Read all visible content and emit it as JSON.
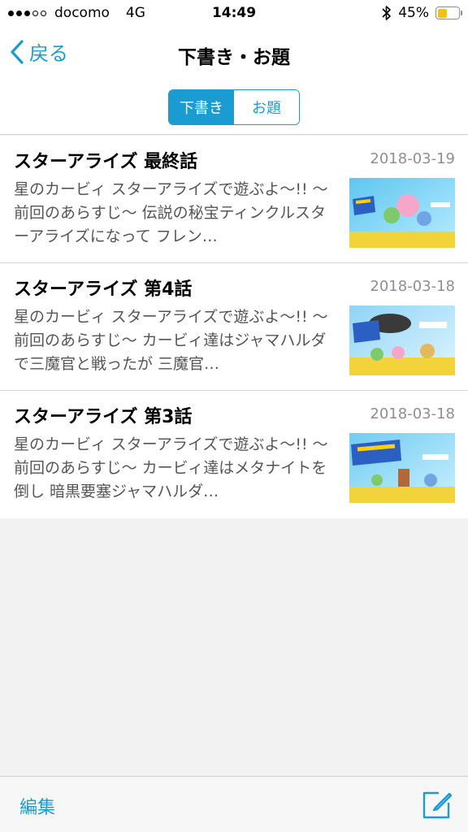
{
  "status_bar": {
    "carrier": "docomo",
    "network": "4G",
    "time": "14:49",
    "battery_text": "45%",
    "battery_level": 0.45,
    "signal_bars": 3,
    "icons": [
      "signal-dots",
      "bluetooth-icon",
      "battery-icon"
    ]
  },
  "nav": {
    "back_label": "戻る",
    "title": "下書き・お題"
  },
  "segments": [
    {
      "label": "下書き",
      "active": true
    },
    {
      "label": "お題",
      "active": false
    }
  ],
  "entries": [
    {
      "title": "スターアライズ 最終話",
      "date": "2018-03-19",
      "excerpt": "星のカービィ スターアライズで遊ぶよ〜!! 〜前回のあらすじ〜 伝説の秘宝ティンクルスターアライズになって フレン…"
    },
    {
      "title": "スターアライズ 第4話",
      "date": "2018-03-18",
      "excerpt": "星のカービィ スターアライズで遊ぶよ〜!! 〜前回のあらすじ〜 カービィ達はジャマハルダで三魔官と戦ったが 三魔官…"
    },
    {
      "title": "スターアライズ 第3話",
      "date": "2018-03-18",
      "excerpt": "星のカービィ スターアライズで遊ぶよ〜!! 〜前回のあらすじ〜 カービィ達はメタナイトを倒し 暗黒要塞ジャマハルダ…"
    }
  ],
  "toolbar": {
    "edit_label": "編集"
  },
  "colors": {
    "accent": "#1a9bd2",
    "battery": "#f5c400",
    "date": "#8e8e93",
    "background": "#f2f2f2"
  }
}
